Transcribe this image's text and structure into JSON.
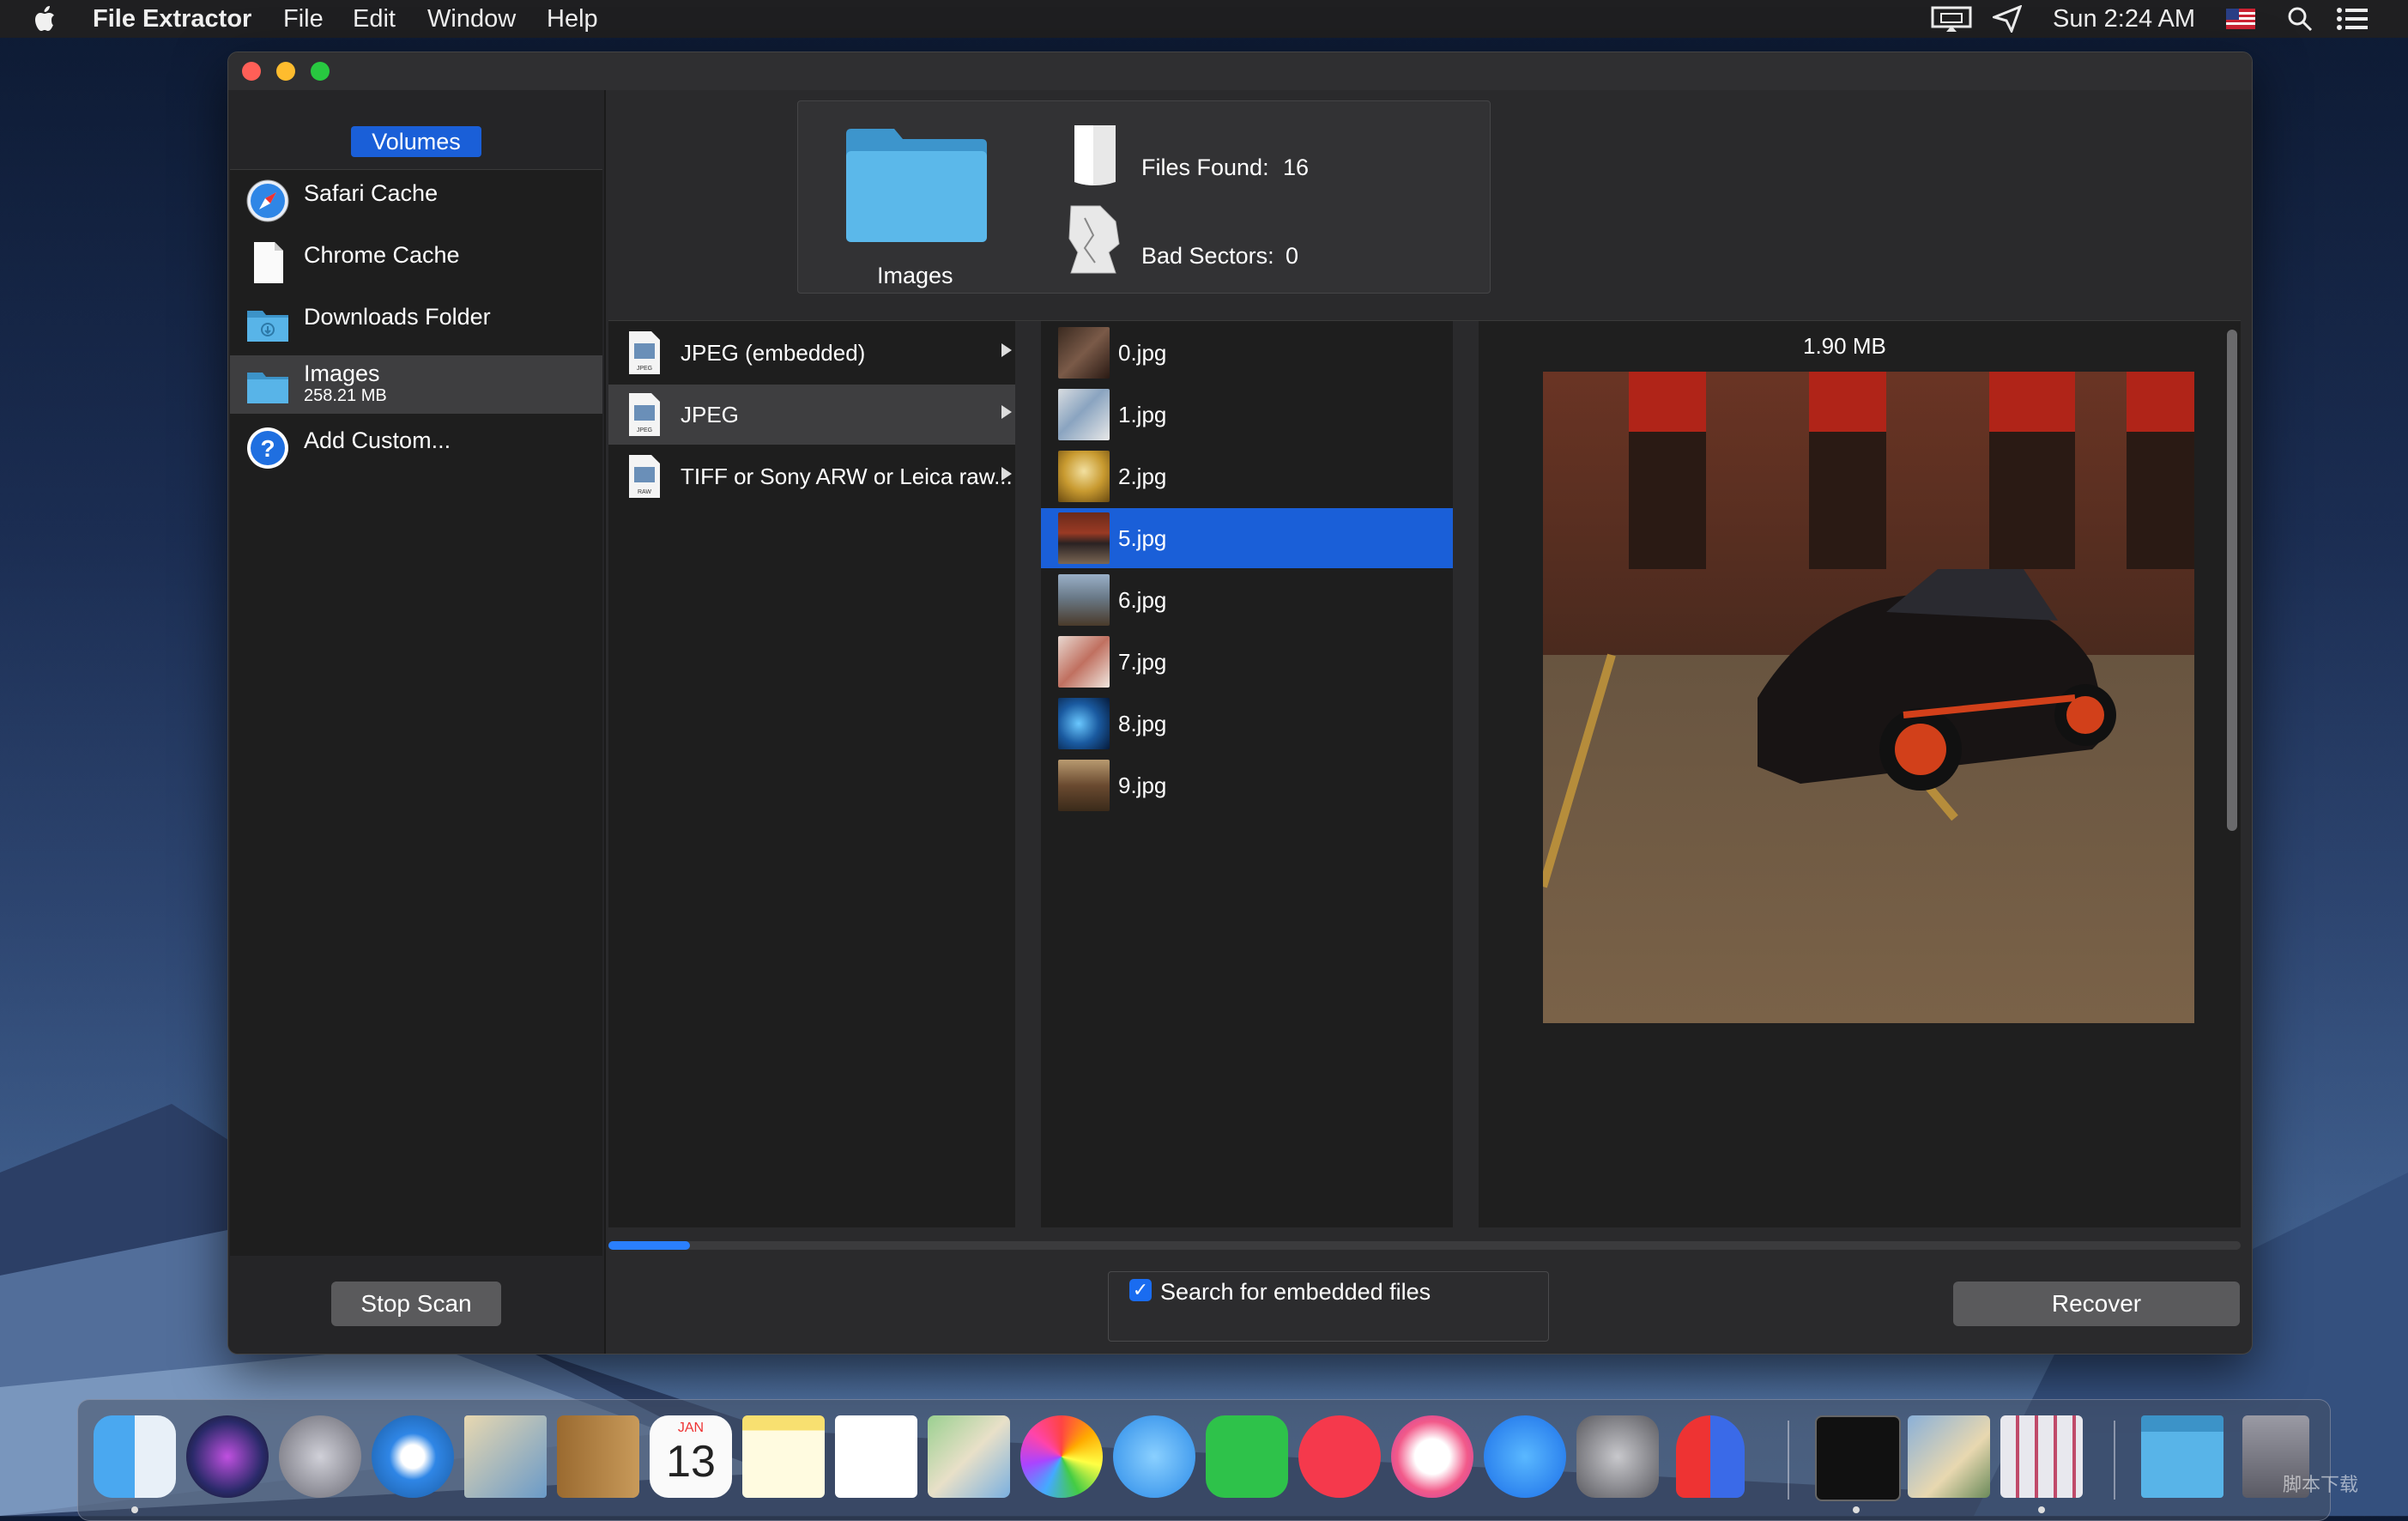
{
  "menubar": {
    "app_name": "File Extractor",
    "menus": [
      "File",
      "Edit",
      "Window",
      "Help"
    ],
    "clock": "Sun 2:24 AM",
    "status_icons": [
      "airplay-icon",
      "location-icon",
      "flag-us-icon",
      "spotlight-search-icon",
      "notification-center-icon"
    ]
  },
  "sidebar": {
    "header": "Volumes",
    "items": [
      {
        "label": "Safari Cache",
        "icon": "safari-icon"
      },
      {
        "label": "Chrome Cache",
        "icon": "document-icon"
      },
      {
        "label": "Downloads Folder",
        "icon": "folder-icon"
      },
      {
        "label": "Images",
        "sub": "258.21 MB",
        "icon": "folder-icon",
        "selected": true
      },
      {
        "label": "Add Custom...",
        "icon": "help-icon"
      }
    ],
    "stop_label": "Stop Scan"
  },
  "info": {
    "volume_name": "Images",
    "files_found_label": "Files Found:",
    "files_found": "16",
    "bad_sectors_label": "Bad Sectors:",
    "bad_sectors": "0"
  },
  "types": [
    {
      "label": "JPEG (embedded)",
      "icon_tag": "JPEG"
    },
    {
      "label": "JPEG",
      "icon_tag": "JPEG",
      "selected": true
    },
    {
      "label": "TIFF or Sony ARW or Leica raw...",
      "icon_tag": "RAW"
    }
  ],
  "files": [
    {
      "name": "0.jpg"
    },
    {
      "name": "1.jpg"
    },
    {
      "name": "2.jpg"
    },
    {
      "name": "5.jpg",
      "selected": true
    },
    {
      "name": "6.jpg"
    },
    {
      "name": "7.jpg"
    },
    {
      "name": "8.jpg"
    },
    {
      "name": "9.jpg"
    }
  ],
  "preview": {
    "size": "1.90 MB"
  },
  "scan_progress": 0.05,
  "options": {
    "embedded_label": "Search for embedded files",
    "embedded_checked": true
  },
  "recover_label": "Recover",
  "dock": {
    "apps": [
      "finder-icon",
      "siri-icon",
      "launchpad-icon",
      "safari-icon",
      "mail-icon",
      "contacts-icon",
      "calendar-icon",
      "notes-icon",
      "reminders-icon",
      "maps-icon",
      "photos-icon",
      "messages-icon",
      "facetime-icon",
      "news-icon",
      "music-icon",
      "app-store-icon",
      "system-preferences-icon",
      "magnet-icon",
      "terminal-icon",
      "preview-icon",
      "file-extractor-icon",
      "downloads-folder-icon",
      "trash-icon"
    ],
    "calendar_month": "JAN",
    "calendar_day": "13"
  },
  "watermark": "脚本下载",
  "colors": {
    "accent": "#1a5fd8",
    "window": "#2a2a2c",
    "progress": "#2a7fff"
  }
}
